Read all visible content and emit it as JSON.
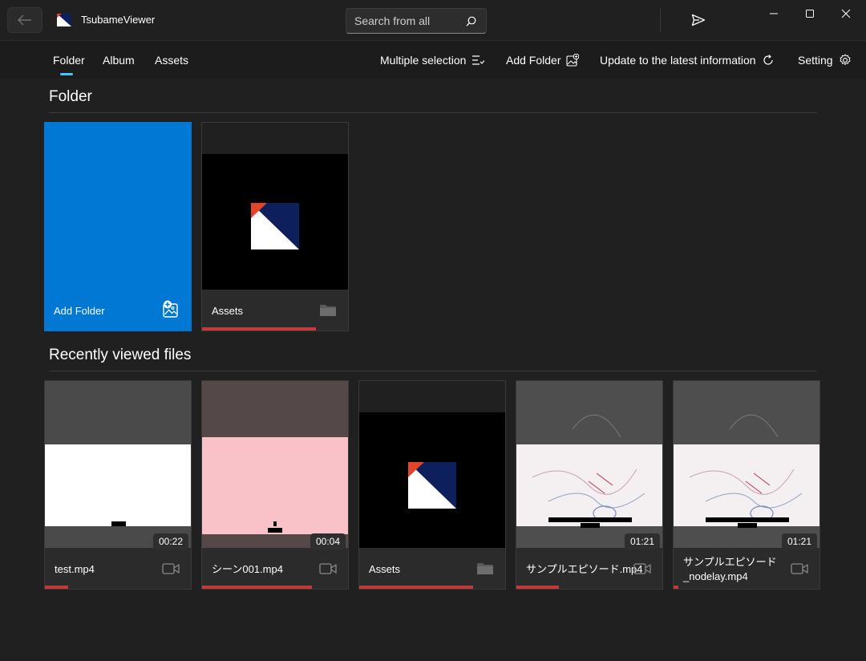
{
  "window": {
    "app_title": "TsubameViewer"
  },
  "search": {
    "placeholder": "Search from all"
  },
  "nav": {
    "tabs": [
      {
        "label": "Folder",
        "selected": true
      },
      {
        "label": "Album",
        "selected": false
      },
      {
        "label": "Assets",
        "selected": false
      }
    ]
  },
  "commands": {
    "multiple_selection": "Multiple selection",
    "add_folder": "Add Folder",
    "update": "Update to the latest information",
    "setting": "Setting"
  },
  "folder_section": {
    "title": "Folder",
    "items": [
      {
        "label": "Add Folder",
        "type": "add-folder"
      },
      {
        "label": "Assets",
        "type": "folder",
        "progress": 0.78
      }
    ]
  },
  "recent_section": {
    "title": "Recently viewed files",
    "items": [
      {
        "label": "test.mp4",
        "duration": "00:22",
        "type": "video",
        "progress": 0.16
      },
      {
        "label": "シーン001.mp4",
        "duration": "00:04",
        "type": "video",
        "progress": 0.75
      },
      {
        "label": "Assets",
        "type": "folder",
        "progress": 0.78
      },
      {
        "label": "サンプルエピソード.mp4",
        "duration": "01:21",
        "type": "video",
        "progress": 0.29
      },
      {
        "label": "サンプルエピソード\n_nodelay.mp4",
        "label_line1": "サンプルエピソード",
        "label_line2": "_nodelay.mp4",
        "duration": "01:21",
        "type": "video",
        "progress": 0.03
      }
    ]
  },
  "colors": {
    "accent": "#0078d4",
    "nav_indicator": "#4cc2ff",
    "progress": "#c4393b",
    "background": "#202020"
  },
  "icons": {
    "back": "arrow-left-icon",
    "search": "search-icon",
    "send": "send-icon",
    "multiple_selection": "multi-select-icon",
    "add_folder": "add-image-icon",
    "update": "refresh-icon",
    "setting": "gear-icon",
    "folder": "folder-icon",
    "video": "video-camera-icon"
  }
}
